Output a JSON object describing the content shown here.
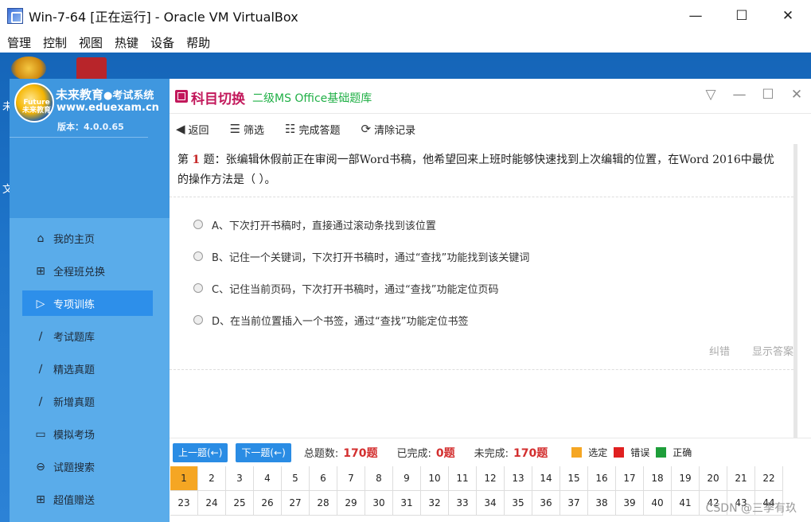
{
  "vbox": {
    "title": "Win-7-64 [正在运行] - Oracle VM VirtualBox",
    "menu": [
      "管理",
      "控制",
      "视图",
      "热键",
      "设备",
      "帮助"
    ],
    "win_controls": {
      "minimize": "—",
      "maximize": "☐",
      "close": "✕"
    }
  },
  "desktop": {
    "icon_text_1": "未",
    "icon_text_2": "文"
  },
  "sidebar": {
    "brand": "未来教育",
    "brand_sub": "●考试系统",
    "url": "www.eduexam.cn",
    "version": "版本：4.0.0.65",
    "logo_text": "Future 未来教育",
    "items": [
      {
        "label": "我的主页",
        "icon": "home-icon",
        "glyph": "⌂"
      },
      {
        "label": "全程班兑换",
        "icon": "gift-icon",
        "glyph": "⊞"
      },
      {
        "label": "专项训练",
        "icon": "play-icon",
        "glyph": "▷"
      },
      {
        "label": "考试题库",
        "icon": "pencil-icon",
        "glyph": "∕"
      },
      {
        "label": "精选真题",
        "icon": "pencil-icon",
        "glyph": "∕"
      },
      {
        "label": "新增真题",
        "icon": "pencil-icon",
        "glyph": "∕"
      },
      {
        "label": "模拟考场",
        "icon": "monitor-icon",
        "glyph": "▭"
      },
      {
        "label": "试题搜索",
        "icon": "search-icon",
        "glyph": "⊖"
      },
      {
        "label": "超值赠送",
        "icon": "gift-icon",
        "glyph": "⊞"
      }
    ]
  },
  "header": {
    "switch_label": "科目切换",
    "subject": "二级MS Office基础题库",
    "controls": {
      "dropdown": "▽",
      "minimize": "—",
      "maximize": "☐",
      "close": "✕"
    }
  },
  "toolbar": {
    "back": "返回",
    "filter": "筛选",
    "finish": "完成答题",
    "clear": "清除记录"
  },
  "question": {
    "prefix": "第",
    "number": "1",
    "suffix": "题：张编辑休假前正在审阅一部Word书稿，他希望回来上班时能够快速找到上次编辑的位置，在Word 2016中最优的操作方法是（ ）。",
    "options": [
      "A、下次打开书稿时，直接通过滚动条找到该位置",
      "B、记住一个关键词，下次打开书稿时，通过“查找”功能找到该关键词",
      "C、记住当前页码，下次打开书稿时，通过“查找”功能定位页码",
      "D、在当前位置插入一个书签，通过“查找”功能定位书签"
    ],
    "report_error": "纠错",
    "show_answer": "显示答案"
  },
  "footer": {
    "prev": "上一题(←)",
    "next": "下一题(←)",
    "total_label": "总题数:",
    "total_value": "170题",
    "done_label": "已完成:",
    "done_value": "0题",
    "undone_label": "未完成:",
    "undone_value": "170题",
    "legend": [
      {
        "label": "选定",
        "color": "#f5a623"
      },
      {
        "label": "错误",
        "color": "#e02020"
      },
      {
        "label": "正确",
        "color": "#1e9e3a"
      }
    ]
  },
  "grid": {
    "row1": [
      "1",
      "2",
      "3",
      "4",
      "5",
      "6",
      "7",
      "8",
      "9",
      "10",
      "11",
      "12",
      "13",
      "14",
      "15",
      "16",
      "17",
      "18",
      "19",
      "20",
      "21",
      "22"
    ],
    "row2": [
      "23",
      "24",
      "25",
      "26",
      "27",
      "28",
      "29",
      "30",
      "31",
      "32",
      "33",
      "34",
      "35",
      "36",
      "37",
      "38",
      "39",
      "40",
      "41",
      "42",
      "43",
      "44"
    ]
  },
  "watermark": "CSDN @三季有玖"
}
